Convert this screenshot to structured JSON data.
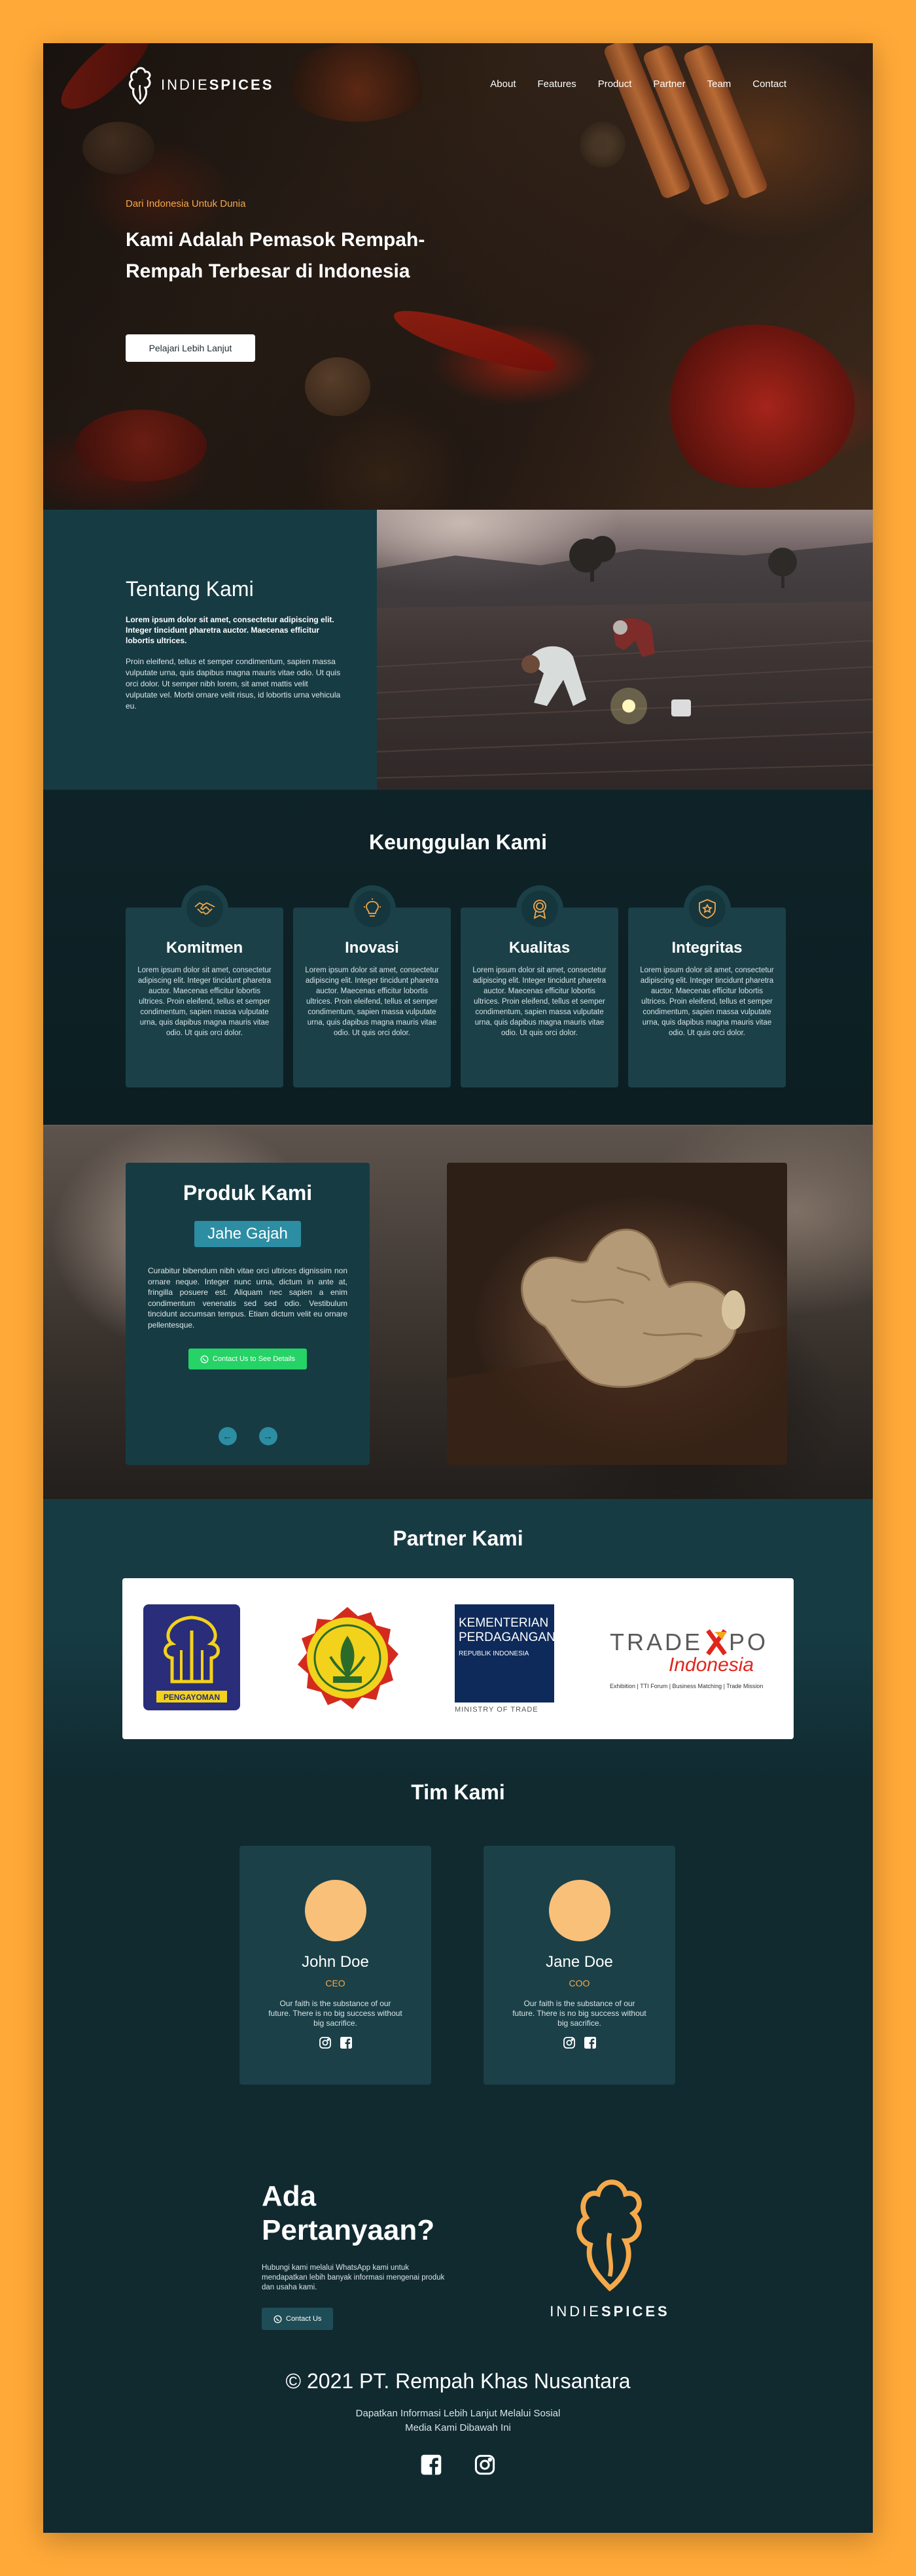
{
  "brand": {
    "prefix": "INDIE",
    "suffix": "SPICES"
  },
  "nav": {
    "items": [
      "About",
      "Features",
      "Product",
      "Partner",
      "Team",
      "Contact"
    ]
  },
  "hero": {
    "eyebrow": "Dari Indonesia Untuk Dunia",
    "title": "Kami Adalah Pemasok Rempah-Rempah Terbesar di Indonesia",
    "button": "Pelajari Lebih Lanjut"
  },
  "about": {
    "title": "Tentang Kami",
    "lead": "Lorem ipsum dolor sit amet, consectetur adipiscing elit. Integer tincidunt pharetra auctor. Maecenas efficitur lobortis ultrices.",
    "body": "Proin eleifend, tellus et semper condimentum, sapien massa vulputate urna, quis dapibus magna mauris vitae odio. Ut quis orci dolor. Ut semper nibh lorem, sit amet mattis velit vulputate vel. Morbi ornare velit risus, id lobortis urna vehicula eu."
  },
  "advantages": {
    "title": "Keunggulan Kami",
    "body": "Lorem ipsum dolor sit amet, consectetur adipiscing elit. Integer tincidunt pharetra auctor. Maecenas efficitur lobortis ultrices. Proin eleifend, tellus et semper condimentum, sapien massa vulputate urna, quis dapibus magna mauris vitae odio. Ut quis orci dolor.",
    "cards": [
      {
        "title": "Komitmen",
        "icon": "handshake-icon"
      },
      {
        "title": "Inovasi",
        "icon": "lightbulb-icon"
      },
      {
        "title": "Kualitas",
        "icon": "medal-icon"
      },
      {
        "title": "Integritas",
        "icon": "shield-star-icon"
      }
    ]
  },
  "product": {
    "title": "Produk Kami",
    "name": "Jahe Gajah",
    "body": "Curabitur bibendum nibh vitae orci ultrices dignissim non ornare neque. Integer nunc urna, dictum in ante at, fringilla posuere est. Aliquam nec sapien a enim condimentum venenatis sed sed odio. Vestibulum tincidunt accumsan tempus. Etiam dictum velit eu ornare pellentesque.",
    "cta": "Contact Us to See Details",
    "prev": "←",
    "next": "→"
  },
  "partners": {
    "title": "Partner Kami",
    "logos": [
      {
        "name": "PENGAYOMAN"
      },
      {
        "name": "Kementerian Pertanian"
      },
      {
        "name": "KEMENTERIAN PERDAGANGAN",
        "line2": "REPUBLIK INDONESIA",
        "line3": "MINISTRY OF TRADE"
      },
      {
        "name": "TRADE EXPO",
        "line2": "Indonesia",
        "line3": "Exhibition | TTI Forum | Business Matching | Trade Mission"
      }
    ]
  },
  "team": {
    "title": "Tim Kami",
    "members": [
      {
        "name": "John Doe",
        "role": "CEO",
        "quote": "Our faith is the substance of our future. There is no big success without big sacrifice."
      },
      {
        "name": "Jane Doe",
        "role": "COO",
        "quote": "Our faith is the substance of our future. There is no big success without big sacrifice."
      }
    ]
  },
  "contact": {
    "title": "Ada Pertanyaan?",
    "body": "Hubungi kami melalui WhatsApp kami untuk mendapatkan lebih banyak informasi mengenai produk dan usaha kami.",
    "button": "Contact Us"
  },
  "footer": {
    "copyright": "© 2021 PT. Rempah Khas Nusantara",
    "subtitle": "Dapatkan Informasi Lebih Lanjut Melalui Sosial Media Kami Dibawah Ini"
  },
  "colors": {
    "background": "#FFA938",
    "primary": "#173B43",
    "accent": "#F6A94A",
    "teal": "#2C8DA3",
    "whatsapp": "#25D366"
  }
}
